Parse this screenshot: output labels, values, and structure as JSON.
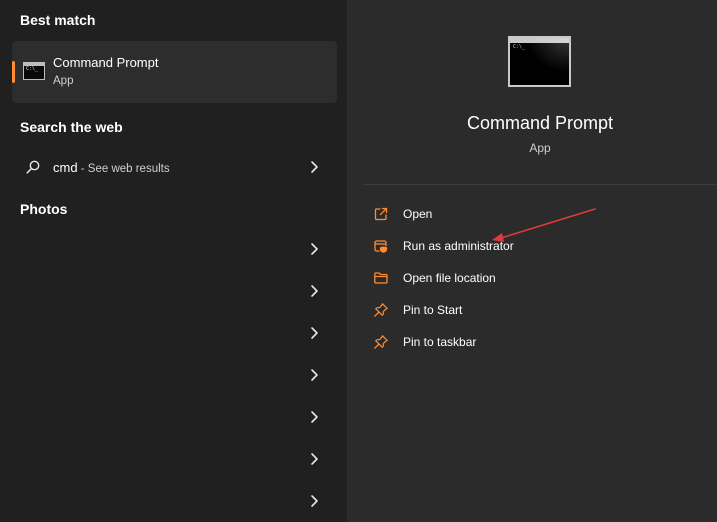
{
  "left_panel": {
    "best_match": {
      "heading": "Best match",
      "item": {
        "title": "Command Prompt",
        "subtitle": "App",
        "icon": "command-prompt-icon"
      }
    },
    "search_web": {
      "heading": "Search the web",
      "item": {
        "query": "cmd",
        "suffix": " - See web results",
        "icon": "search-icon"
      }
    },
    "photos": {
      "heading": "Photos",
      "row_count": 7
    }
  },
  "right_panel": {
    "app": {
      "title": "Command Prompt",
      "type": "App",
      "icon": "command-prompt-icon"
    },
    "actions": [
      {
        "label": "Open",
        "icon": "open-external-icon"
      },
      {
        "label": "Run as administrator",
        "icon": "admin-shield-icon"
      },
      {
        "label": "Open file location",
        "icon": "folder-icon"
      },
      {
        "label": "Pin to Start",
        "icon": "pin-icon"
      },
      {
        "label": "Pin to taskbar",
        "icon": "pin-icon"
      }
    ],
    "annotation": {
      "icon": "red-arrow-annotation"
    }
  },
  "colors": {
    "accent": "#ff8c32",
    "left_bg": "#202020",
    "right_bg": "#2b2b2b",
    "selected_bg": "#2d2d2d",
    "annotation": "#e03c3c"
  }
}
